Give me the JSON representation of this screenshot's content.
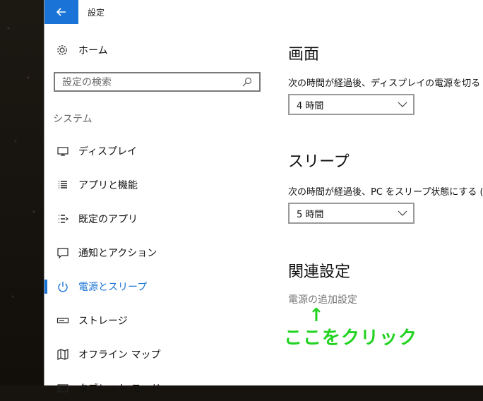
{
  "window": {
    "title": "設定"
  },
  "nav": {
    "home_label": "ホーム",
    "search_placeholder": "設定の検索",
    "section_label": "システム",
    "items": [
      {
        "label": "ディスプレイ",
        "icon": "display-icon"
      },
      {
        "label": "アプリと機能",
        "icon": "apps-list-icon"
      },
      {
        "label": "既定のアプリ",
        "icon": "default-apps-icon"
      },
      {
        "label": "通知とアクション",
        "icon": "notification-icon"
      },
      {
        "label": "電源とスリープ",
        "icon": "power-icon",
        "active": true
      },
      {
        "label": "ストレージ",
        "icon": "storage-icon"
      },
      {
        "label": "オフライン マップ",
        "icon": "map-icon"
      },
      {
        "label": "タブレット モード",
        "icon": "tablet-mode-icon"
      }
    ]
  },
  "content": {
    "screen": {
      "heading": "画面",
      "description": "次の時間が経過後、ディスプレイの電源を切る (",
      "value": "4 時間"
    },
    "sleep": {
      "heading": "スリープ",
      "description": "次の時間が経過後、PC をスリープ状態にする (バ",
      "value": "5 時間"
    },
    "related": {
      "heading": "関連設定",
      "link": "電源の追加設定"
    },
    "annotation": {
      "arrow": "↑",
      "text": "ここをクリック"
    }
  },
  "colors": {
    "accent": "#1a73d6",
    "annotation": "#22d322"
  }
}
